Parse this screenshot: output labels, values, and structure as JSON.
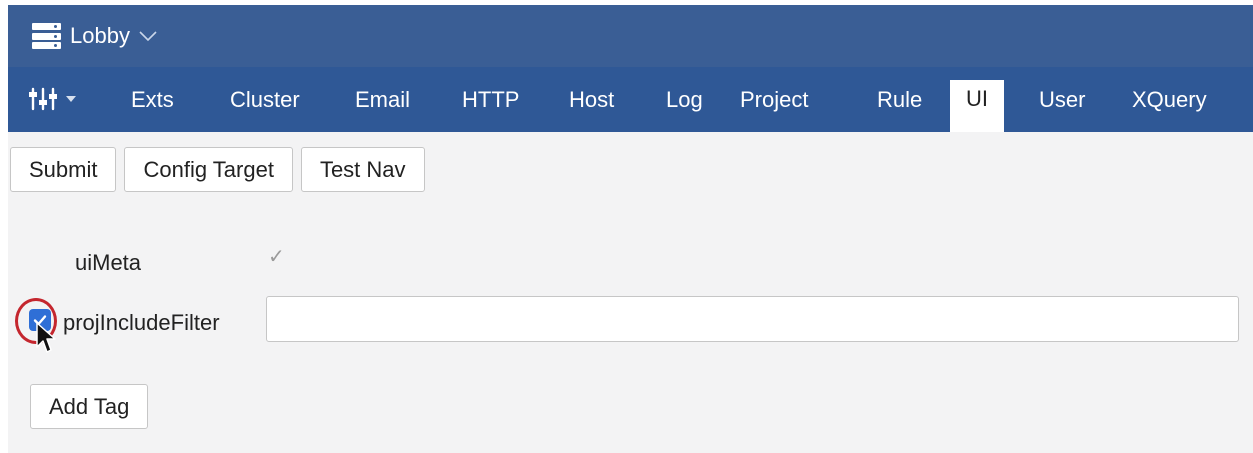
{
  "header": {
    "title": "Lobby",
    "title_icon": "server-icon",
    "dropdown_icon": "chevron-down-icon"
  },
  "nav": {
    "tools_icon": "sliders-icon",
    "tabs": [
      {
        "label": "Exts"
      },
      {
        "label": "Cluster"
      },
      {
        "label": "Email"
      },
      {
        "label": "HTTP"
      },
      {
        "label": "Host"
      },
      {
        "label": "Log"
      },
      {
        "label": "Project"
      },
      {
        "label": "Rule"
      },
      {
        "label": "UI",
        "active": true
      },
      {
        "label": "User"
      },
      {
        "label": "XQuery"
      }
    ]
  },
  "toolbar": {
    "submit_label": "Submit",
    "config_target_label": "Config Target",
    "test_nav_label": "Test Nav"
  },
  "form": {
    "ui_meta": {
      "label": "uiMeta",
      "value_mark": "✓"
    },
    "proj_include_filter": {
      "label": "projIncludeFilter",
      "checked": true,
      "value": "",
      "placeholder": ""
    },
    "add_tag_label": "Add Tag"
  },
  "colors": {
    "header_bg": "#3a5e95",
    "tabbar_bg": "#2f5896",
    "checkbox_blue": "#2f6fd6",
    "highlight_ring": "#c4262e"
  }
}
